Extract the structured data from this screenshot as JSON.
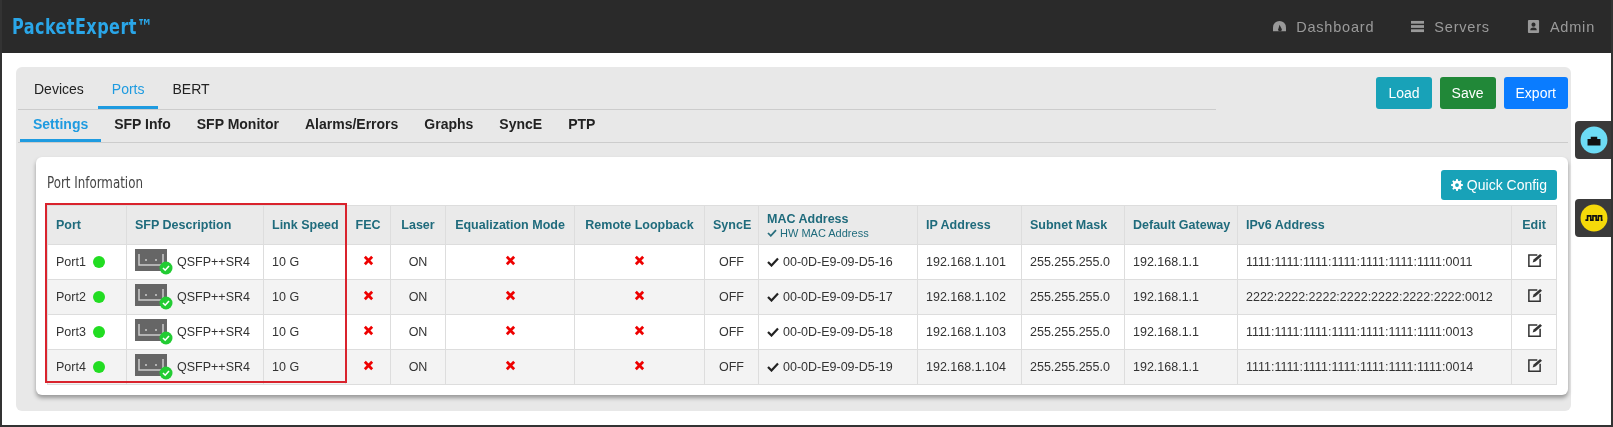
{
  "brand": "PacketExpert™",
  "nav": [
    {
      "kind": "dashboard",
      "label": "Dashboard"
    },
    {
      "kind": "servers",
      "label": "Servers"
    },
    {
      "kind": "admin",
      "label": "Admin"
    }
  ],
  "tabs": [
    {
      "label": "Devices",
      "selected": false
    },
    {
      "label": "Ports",
      "selected": true
    },
    {
      "label": "BERT",
      "selected": false
    }
  ],
  "subtabs": [
    {
      "label": "Settings",
      "selected": true
    },
    {
      "label": "SFP Info",
      "selected": false
    },
    {
      "label": "SFP Monitor",
      "selected": false
    },
    {
      "label": "Alarms/Errors",
      "selected": false
    },
    {
      "label": "Graphs",
      "selected": false
    },
    {
      "label": "SyncE",
      "selected": false
    },
    {
      "label": "PTP",
      "selected": false
    }
  ],
  "actions": [
    {
      "label": "Load",
      "kind": "info"
    },
    {
      "label": "Save",
      "kind": "success"
    },
    {
      "label": "Export",
      "kind": "primary"
    }
  ],
  "panel": {
    "title": "Port Information",
    "quick_config": "Quick Config",
    "columns": [
      "Port",
      "SFP Description",
      "Link Speed",
      "FEC",
      "Laser",
      "Equalization Mode",
      "Remote Loopback",
      "SyncE",
      "MAC Address",
      "IP Address",
      "Subnet Mask",
      "Default Gateway",
      "IPv6 Address",
      "Edit"
    ],
    "mac_sub": "HW MAC Address",
    "rows": [
      {
        "port": "Port1",
        "link_up": true,
        "sfp": "QSFP++SR4",
        "sfp_ok": true,
        "speed": "10 G",
        "fec": false,
        "laser": "ON",
        "equalization": false,
        "remote_loopback": false,
        "synce": "OFF",
        "hw_mac": true,
        "mac": "00-0D-E9-09-D5-16",
        "ip": "192.168.1.101",
        "mask": "255.255.255.0",
        "gateway": "192.168.1.1",
        "ipv6": "1111:1111:1111:1111:1111:1111:1111:0011"
      },
      {
        "port": "Port2",
        "link_up": true,
        "sfp": "QSFP++SR4",
        "sfp_ok": true,
        "speed": "10 G",
        "fec": false,
        "laser": "ON",
        "equalization": false,
        "remote_loopback": false,
        "synce": "OFF",
        "hw_mac": true,
        "mac": "00-0D-E9-09-D5-17",
        "ip": "192.168.1.102",
        "mask": "255.255.255.0",
        "gateway": "192.168.1.1",
        "ipv6": "2222:2222:2222:2222:2222:2222:2222:0012"
      },
      {
        "port": "Port3",
        "link_up": true,
        "sfp": "QSFP++SR4",
        "sfp_ok": true,
        "speed": "10 G",
        "fec": false,
        "laser": "ON",
        "equalization": false,
        "remote_loopback": false,
        "synce": "OFF",
        "hw_mac": true,
        "mac": "00-0D-E9-09-D5-18",
        "ip": "192.168.1.103",
        "mask": "255.255.255.0",
        "gateway": "192.168.1.1",
        "ipv6": "1111:1111:1111:1111:1111:1111:1111:0013"
      },
      {
        "port": "Port4",
        "link_up": true,
        "sfp": "QSFP++SR4",
        "sfp_ok": true,
        "speed": "10 G",
        "fec": false,
        "laser": "ON",
        "equalization": false,
        "remote_loopback": false,
        "synce": "OFF",
        "hw_mac": true,
        "mac": "00-0D-E9-09-D5-19",
        "ip": "192.168.1.104",
        "mask": "255.255.255.0",
        "gateway": "192.168.1.1",
        "ipv6": "1111:1111:1111:1111:1111:1111:1111:0014"
      }
    ]
  },
  "side_tabs": [
    {
      "kind": "ethernet"
    },
    {
      "kind": "signal"
    }
  ]
}
